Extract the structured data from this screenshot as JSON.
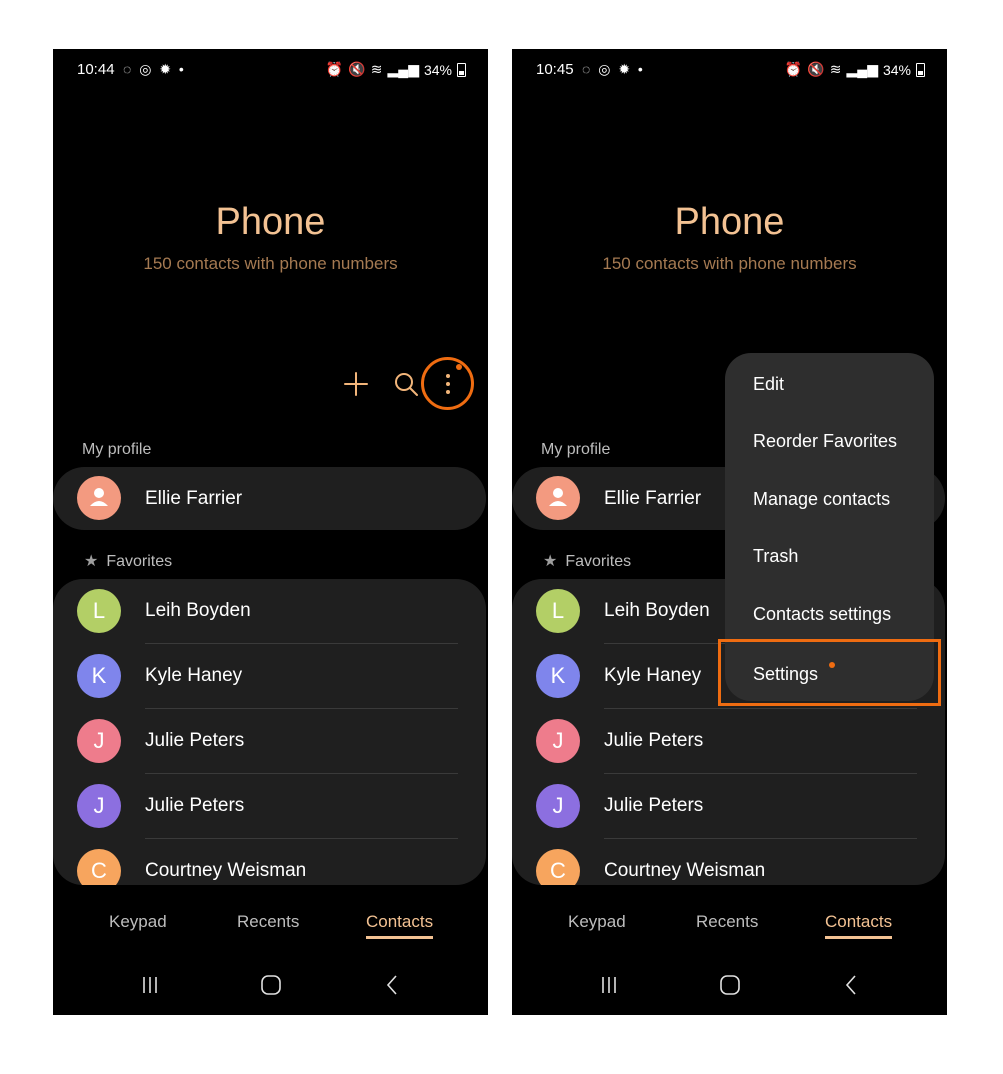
{
  "left": {
    "status": {
      "time": "10:44",
      "battery": "34%"
    },
    "header": {
      "title": "Phone",
      "subtitle": "150 contacts with phone numbers"
    },
    "my_profile_label": "My profile",
    "profile": {
      "name": "Ellie Farrier"
    },
    "favorites_label": "Favorites",
    "favorites": [
      {
        "initial": "L",
        "name": "Leih Boyden",
        "color": "#b3cf66"
      },
      {
        "initial": "K",
        "name": "Kyle Haney",
        "color": "#7f85ec"
      },
      {
        "initial": "J",
        "name": "Julie Peters",
        "color": "#ee7c8c"
      },
      {
        "initial": "J",
        "name": "Julie Peters",
        "color": "#8c6fe0"
      },
      {
        "initial": "C",
        "name": "Courtney Weisman",
        "color": "#f7a55e"
      }
    ],
    "tabs": [
      {
        "label": "Keypad"
      },
      {
        "label": "Recents"
      },
      {
        "label": "Contacts"
      }
    ]
  },
  "right": {
    "status": {
      "time": "10:45",
      "battery": "34%"
    },
    "header": {
      "title": "Phone",
      "subtitle": "150 contacts with phone numbers"
    },
    "my_profile_label": "My profile",
    "profile": {
      "name": "Ellie Farrier"
    },
    "favorites_label": "Favorites",
    "favorites": [
      {
        "initial": "L",
        "name": "Leih Boyden",
        "color": "#b3cf66"
      },
      {
        "initial": "K",
        "name": "Kyle Haney",
        "color": "#7f85ec"
      },
      {
        "initial": "J",
        "name": "Julie Peters",
        "color": "#ee7c8c"
      },
      {
        "initial": "J",
        "name": "Julie Peters",
        "color": "#8c6fe0"
      },
      {
        "initial": "C",
        "name": "Courtney Weisman",
        "color": "#f7a55e"
      }
    ],
    "tabs": [
      {
        "label": "Keypad"
      },
      {
        "label": "Recents"
      },
      {
        "label": "Contacts"
      }
    ],
    "menu": [
      {
        "label": "Edit"
      },
      {
        "label": "Reorder Favorites"
      },
      {
        "label": "Manage contacts"
      },
      {
        "label": "Trash"
      },
      {
        "label": "Contacts settings"
      },
      {
        "label": "Settings"
      }
    ]
  },
  "colors": {
    "accent": "#f3c293",
    "highlight": "#ef6c11",
    "profile_avatar": "#f39a80",
    "background": "#000000",
    "card": "#1f1f1f",
    "menu": "#2e2e2e"
  },
  "icons": [
    "add-icon",
    "search-icon",
    "more-options-icon",
    "star-icon",
    "person-icon",
    "recent-apps-icon",
    "home-icon",
    "back-icon"
  ]
}
